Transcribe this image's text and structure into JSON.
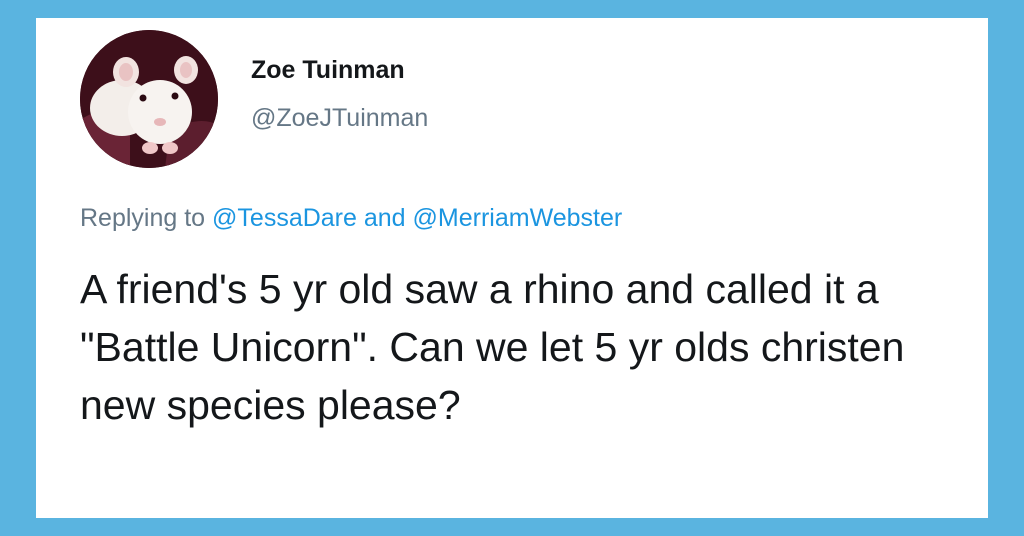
{
  "user": {
    "display_name": "Zoe Tuinman",
    "handle": "@ZoeJTuinman",
    "avatar_icon": "white-rat-avatar"
  },
  "reply": {
    "prefix": "Replying to",
    "mention_1": "@TessaDare",
    "conjunction": "and",
    "mention_2": "@MerriamWebster"
  },
  "tweet": {
    "text": "A friend's 5 yr old saw a rhino and called it a \"Battle Unicorn\". Can we let 5 yr olds christen new species please?"
  },
  "colors": {
    "frame": "#5ab4e0",
    "card": "#ffffff",
    "text": "#14171a",
    "secondary": "#657786",
    "mention": "#1b95e0"
  }
}
